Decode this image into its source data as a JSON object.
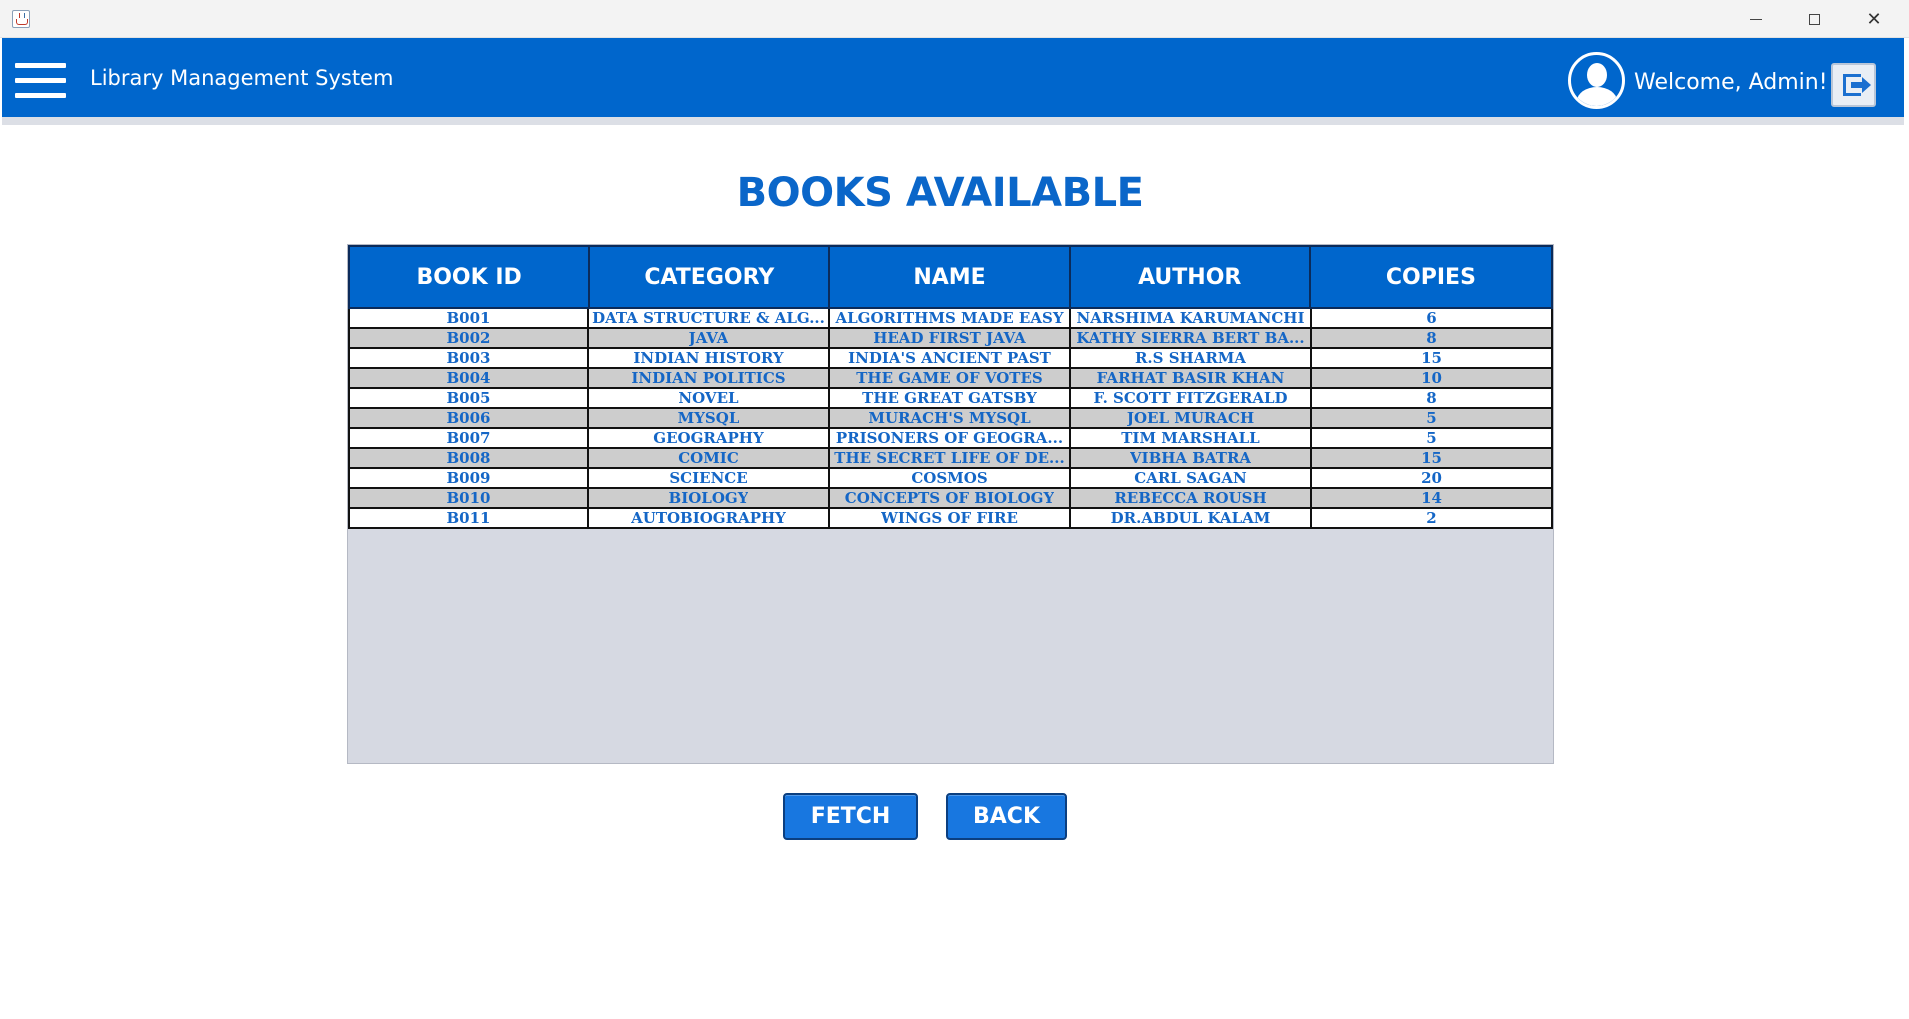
{
  "window": {
    "minimize_glyph": "",
    "maximize_glyph": "",
    "close_glyph": "✕"
  },
  "header": {
    "app_title": "Library Management System",
    "welcome_text": "Welcome, Admin!",
    "brand_color": "#0066cc"
  },
  "main": {
    "page_title": "BOOKS AVAILABLE",
    "table": {
      "columns": [
        "BOOK ID",
        "CATEGORY",
        "NAME",
        "AUTHOR",
        "COPIES"
      ],
      "rows": [
        [
          "B001",
          "DATA STRUCTURE & ALG...",
          "ALGORITHMS MADE EASY",
          "NARSHIMA KARUMANCHI",
          "6"
        ],
        [
          "B002",
          "JAVA",
          "HEAD FIRST JAVA",
          "KATHY SIERRA BERT BA...",
          "8"
        ],
        [
          "B003",
          "INDIAN HISTORY",
          "INDIA'S ANCIENT PAST",
          "R.S SHARMA",
          "15"
        ],
        [
          "B004",
          "INDIAN POLITICS",
          "THE GAME OF VOTES",
          "FARHAT BASIR KHAN",
          "10"
        ],
        [
          "B005",
          "NOVEL",
          "THE GREAT GATSBY",
          "F. SCOTT FITZGERALD",
          "8"
        ],
        [
          "B006",
          "MYSQL",
          "MURACH'S MYSQL",
          "JOEL MURACH",
          "5"
        ],
        [
          "B007",
          "GEOGRAPHY",
          "PRISONERS OF GEOGRA...",
          "TIM MARSHALL",
          "5"
        ],
        [
          "B008",
          "COMIC",
          "THE SECRET LIFE OF DE...",
          "VIBHA BATRA",
          "15"
        ],
        [
          "B009",
          "SCIENCE",
          "COSMOS",
          "CARL SAGAN",
          "20"
        ],
        [
          "B010",
          "BIOLOGY",
          "CONCEPTS OF BIOLOGY",
          "REBECCA ROUSH",
          "14"
        ],
        [
          "B011",
          "AUTOBIOGRAPHY",
          "WINGS OF FIRE",
          "DR.ABDUL KALAM",
          "2"
        ]
      ]
    },
    "buttons": {
      "fetch_label": "FETCH",
      "back_label": "BACK"
    }
  }
}
